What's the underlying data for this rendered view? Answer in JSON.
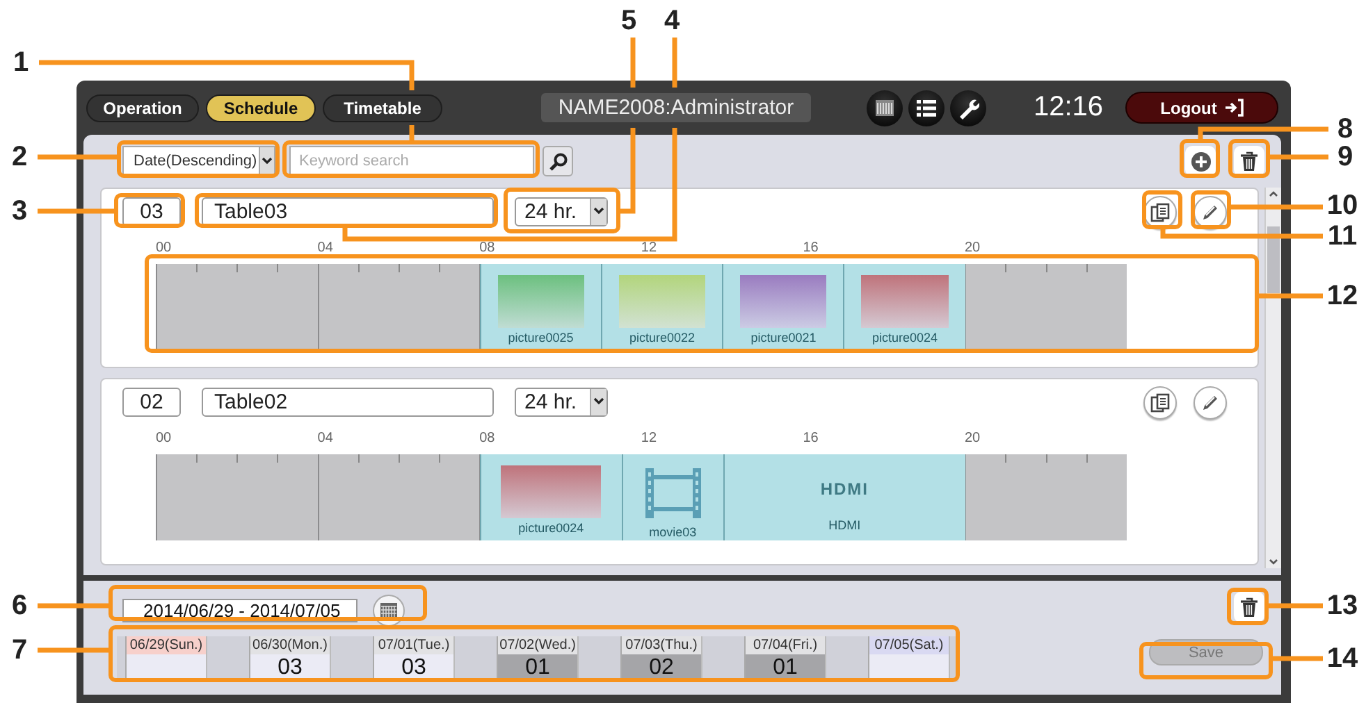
{
  "nav_tabs": [
    {
      "label": "Operation",
      "selected": false
    },
    {
      "label": "Schedule",
      "selected": true
    },
    {
      "label": "Timetable",
      "selected": false
    }
  ],
  "user_label": "NAME2008:Administrator",
  "clock": "12:16",
  "logout_button": "Logout",
  "toolbar": {
    "sort_select": "Date(Descending)",
    "search": {
      "placeholder": "Keyword search"
    }
  },
  "timetables": [
    {
      "number": "03",
      "name": "Table03",
      "duration": "24 hr.",
      "hour_labels": [
        "00",
        "04",
        "08",
        "12",
        "16",
        "20"
      ],
      "blocks": [
        {
          "kind": "picture",
          "label": "picture0025",
          "color": "#6cc07f"
        },
        {
          "kind": "picture",
          "label": "picture0022",
          "color": "#b2d57c"
        },
        {
          "kind": "picture",
          "label": "picture0021",
          "color": "#9a7cc0"
        },
        {
          "kind": "picture",
          "label": "picture0024",
          "color": "#bf737b"
        }
      ]
    },
    {
      "number": "02",
      "name": "Table02",
      "duration": "24 hr.",
      "hour_labels": [
        "00",
        "04",
        "08",
        "12",
        "16",
        "20"
      ],
      "blocks": [
        {
          "kind": "picture",
          "label": "picture0024",
          "color": "#bf737b"
        },
        {
          "kind": "movie",
          "label": "movie03"
        },
        {
          "kind": "hdmi",
          "label": "HDMI",
          "logo": "HDMI"
        }
      ]
    }
  ],
  "date_range": "2014/06/29 - 2014/07/05",
  "days": [
    {
      "label": "06/29(Sun.)",
      "color": "#f7d0cb",
      "shaded": false
    },
    {
      "label": "06/30(Mon.)",
      "color": "#e2e2e4",
      "value": "03",
      "shaded": false
    },
    {
      "label": "07/01(Tue.)",
      "color": "#e2e2e4",
      "value": "03",
      "shaded": false
    },
    {
      "label": "07/02(Wed.)",
      "color": "#e2e2e4",
      "value": "01",
      "shaded": true
    },
    {
      "label": "07/03(Thu.)",
      "color": "#e2e2e4",
      "value": "02",
      "shaded": true
    },
    {
      "label": "07/04(Fri.)",
      "color": "#e2e2e4",
      "value": "01",
      "shaded": true
    },
    {
      "label": "07/05(Sat.)",
      "color": "#d9d9f2",
      "shaded": false
    }
  ],
  "save_button": "Save",
  "callouts": [
    "1",
    "2",
    "3",
    "4",
    "5",
    "6",
    "7",
    "8",
    "9",
    "10",
    "11",
    "12",
    "13",
    "14"
  ]
}
